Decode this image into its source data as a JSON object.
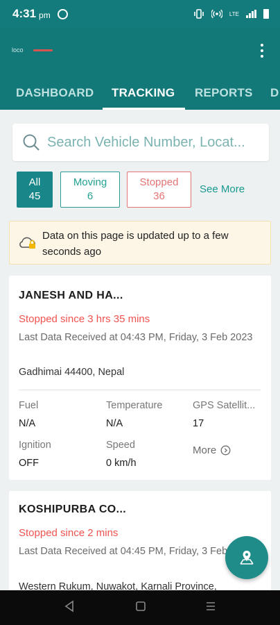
{
  "status_bar": {
    "time": "4:31",
    "ampm": "pm",
    "network": "LTE"
  },
  "app_bar": {
    "logo_text": "loco"
  },
  "tabs": [
    {
      "label": "DASHBOARD"
    },
    {
      "label": "TRACKING"
    },
    {
      "label": "REPORTS"
    },
    {
      "label": "D"
    }
  ],
  "search": {
    "placeholder": "Search Vehicle Number, Locat..."
  },
  "filters": {
    "all": {
      "label": "All",
      "count": "45"
    },
    "moving": {
      "label": "Moving",
      "count": "6"
    },
    "stopped": {
      "label": "Stopped",
      "count": "36"
    },
    "see_more": "See More"
  },
  "notice": {
    "text": "Data on this page is updated up to a few seconds ago"
  },
  "vehicles": [
    {
      "name": "JANESH AND HA...",
      "status": "Stopped since 3 hrs 35 mins",
      "last_data": "Last Data Received at 04:43 PM, Friday, 3 Feb 2023",
      "location": "Gadhimai 44400, Nepal",
      "metrics": {
        "fuel_label": "Fuel",
        "fuel_value": "N/A",
        "temperature_label": "Temperature",
        "temperature_value": "N/A",
        "gps_label": "GPS Satellit...",
        "gps_value": "17",
        "ignition_label": "Ignition",
        "ignition_value": "OFF",
        "speed_label": "Speed",
        "speed_value": "0 km/h",
        "more_label": "More"
      }
    },
    {
      "name": "KOSHIPURBA CO...",
      "status": "Stopped since 2 mins",
      "last_data": "Last Data Received at 04:45 PM, Friday, 3 Feb 2023",
      "location": "Western Rukum, Nuwakot, Karnali Province,"
    }
  ],
  "colors": {
    "primary": "#137b7b",
    "stopped": "#ef5350",
    "moving": "#22a090",
    "notice_bg": "#fdf6e6"
  }
}
